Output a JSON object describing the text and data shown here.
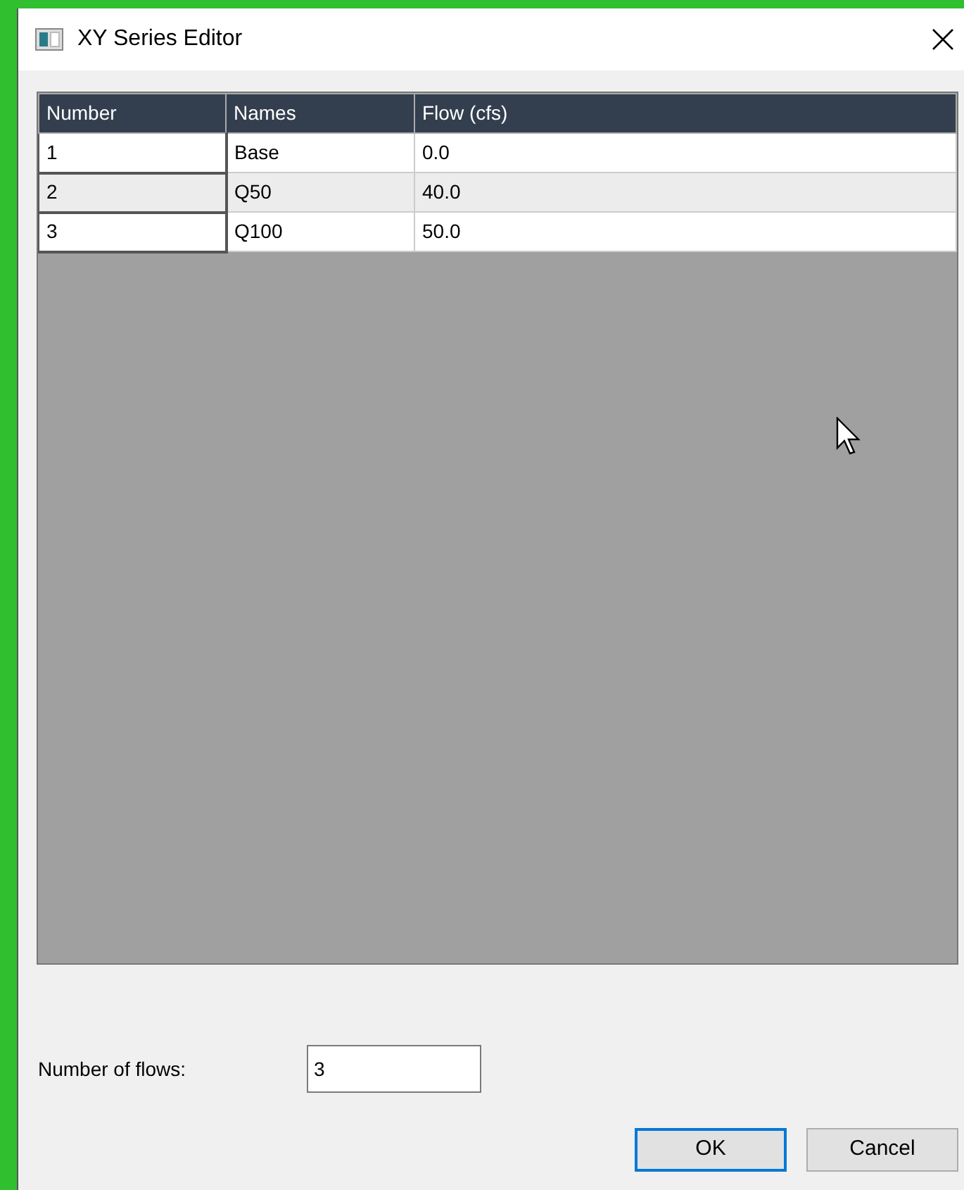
{
  "window": {
    "title": "XY Series Editor"
  },
  "table": {
    "columns": [
      "Number",
      "Names",
      "Flow (cfs)"
    ],
    "rows": [
      {
        "cells": [
          "1",
          "Base",
          "0.0"
        ],
        "selected": false
      },
      {
        "cells": [
          "2",
          "Q50",
          "40.0"
        ],
        "selected": true
      },
      {
        "cells": [
          "3",
          "Q100",
          "50.0"
        ],
        "selected": false
      }
    ]
  },
  "number_of_flows": {
    "label": "Number of flows:",
    "value": "3"
  },
  "buttons": [
    {
      "label": "OK",
      "default": true
    },
    {
      "label": "Cancel",
      "default": false
    }
  ]
}
